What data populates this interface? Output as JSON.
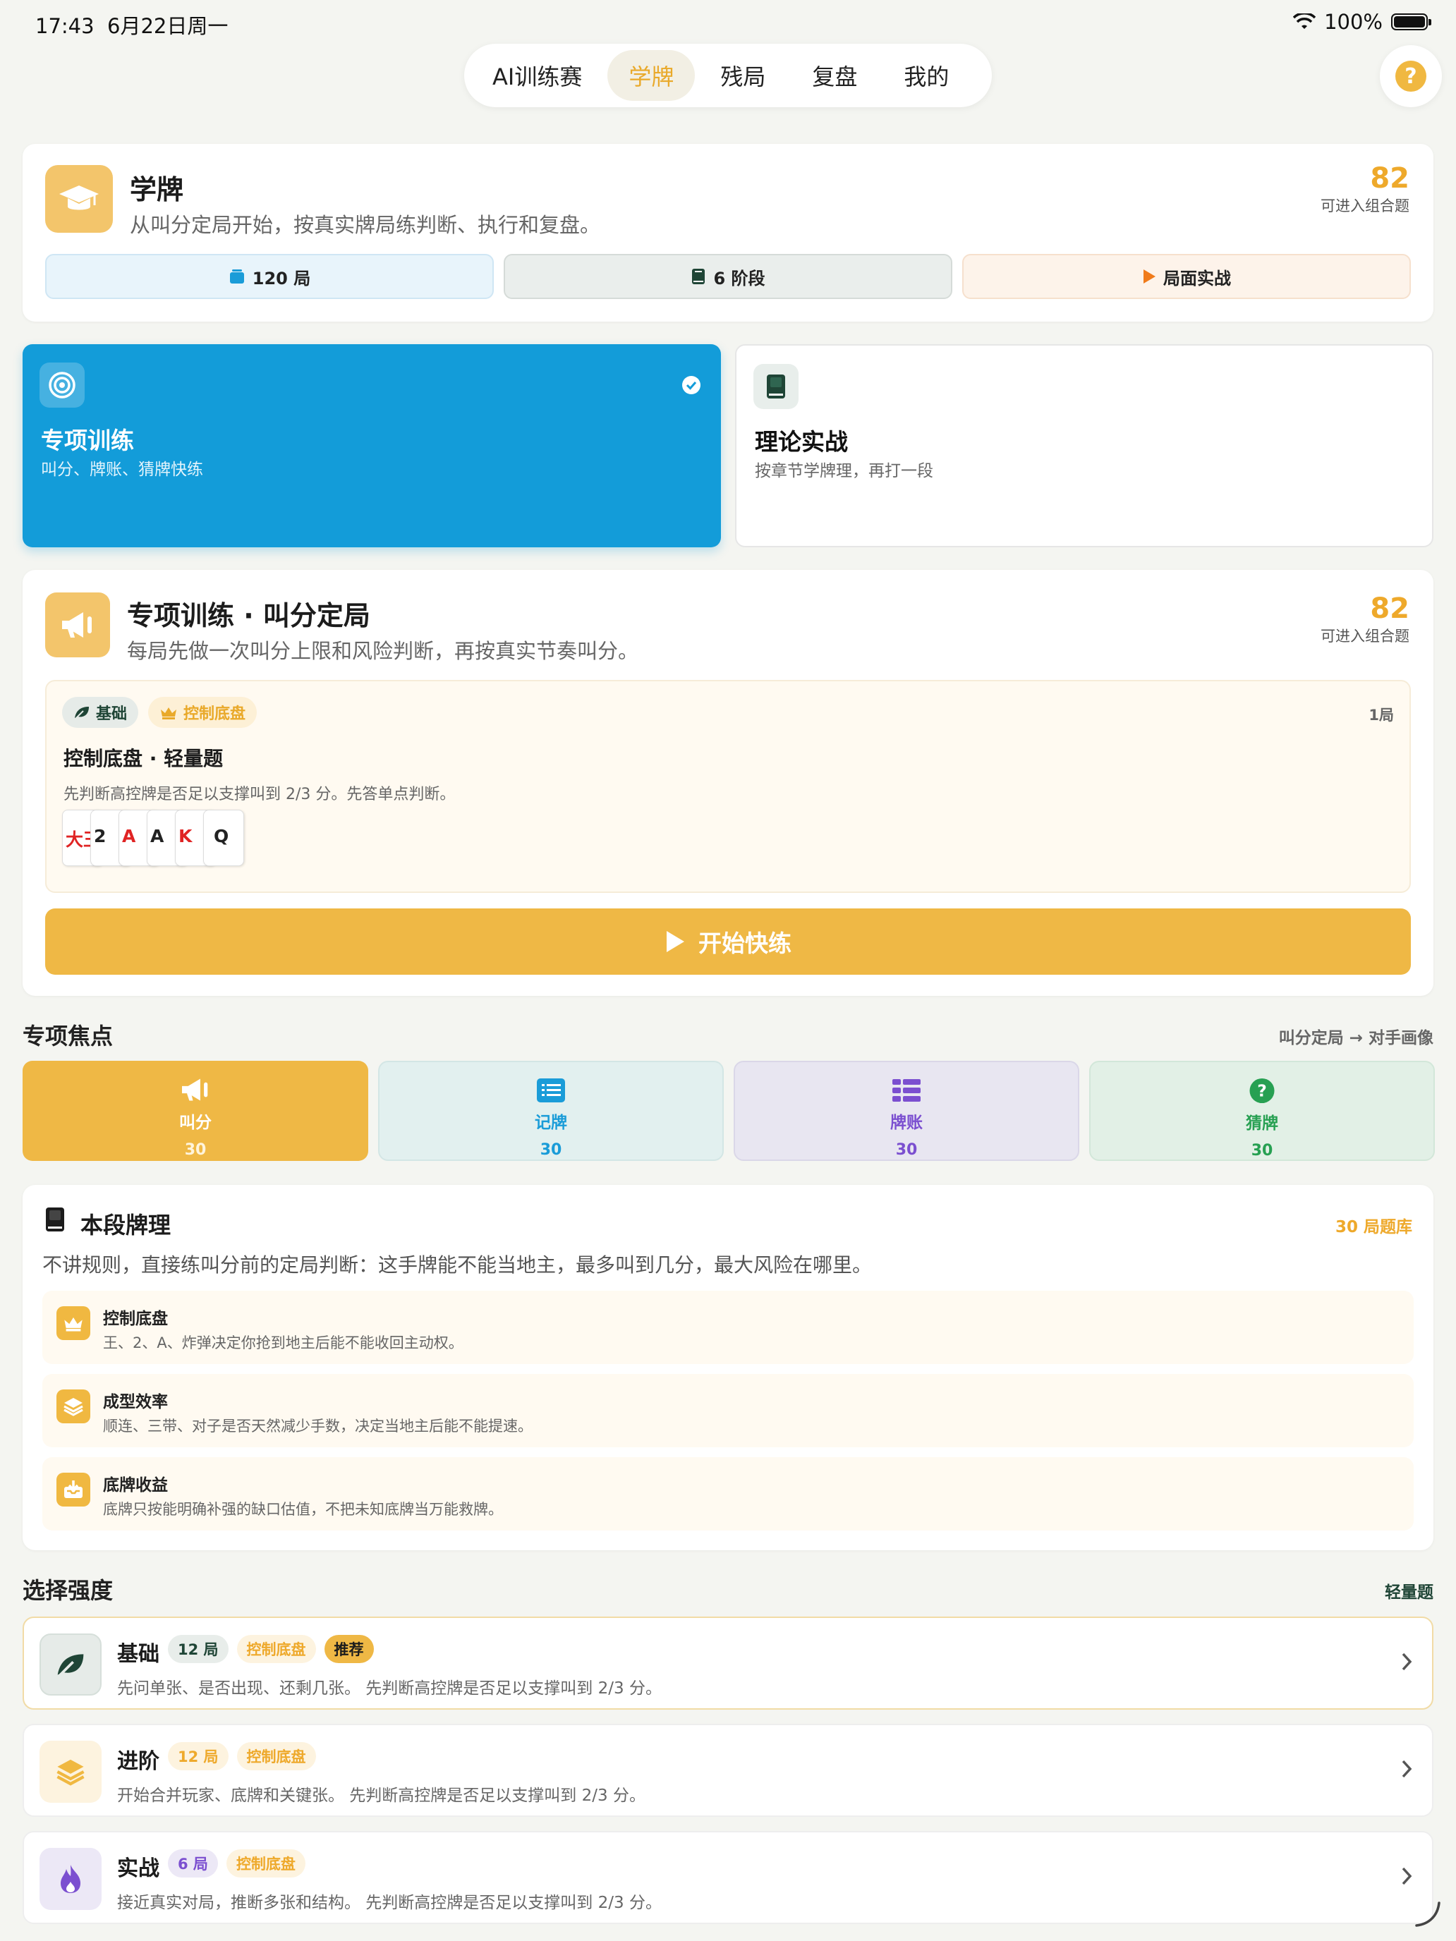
{
  "status": {
    "time": "17:43",
    "date": "6月22日周一",
    "battery": "100%"
  },
  "nav": {
    "tabs": [
      "AI训练赛",
      "学牌",
      "残局",
      "复盘",
      "我的"
    ],
    "active": 1,
    "help": "?"
  },
  "header": {
    "title": "学牌",
    "subtitle": "从叫分定局开始，按真实牌局练判断、执行和复盘。",
    "score": "82",
    "score_label": "可进入组合题",
    "pills": [
      {
        "label": "120 局",
        "icon": "deck-icon"
      },
      {
        "label": "6 阶段",
        "icon": "book-icon"
      },
      {
        "label": "局面实战",
        "icon": "play-icon"
      }
    ]
  },
  "modes": [
    {
      "title": "专项训练",
      "subtitle": "叫分、牌账、猜牌快练",
      "selected": true
    },
    {
      "title": "理论实战",
      "subtitle": "按章节学牌理，再打一段",
      "selected": false
    }
  ],
  "training": {
    "title": "专项训练 · 叫分定局",
    "subtitle": "每局先做一次叫分上限和风险判断，再按真实节奏叫分。",
    "score": "82",
    "score_label": "可进入组合题",
    "question": {
      "tag_level": "基础",
      "tag_topic": "控制底盘",
      "count": "1局",
      "title": "控制底盘 · 轻量题",
      "desc": "先判断高控牌是否足以支撑叫到 2/3 分。先答单点判断。",
      "cards": [
        {
          "label": "大王",
          "color": "#e02424"
        },
        {
          "label": "2",
          "color": "#222222"
        },
        {
          "label": "A",
          "color": "#e02424"
        },
        {
          "label": "A",
          "color": "#222222"
        },
        {
          "label": "K",
          "color": "#e02424"
        },
        {
          "label": "Q",
          "color": "#222222"
        }
      ]
    },
    "start_label": "开始快练"
  },
  "focus": {
    "title": "专项焦点",
    "path": "叫分定局 → 对手画像",
    "items": [
      {
        "label": "叫分",
        "count": "30",
        "bg": "#efb845",
        "fg": "#ffffff",
        "active": true
      },
      {
        "label": "记牌",
        "count": "30",
        "bg": "#e2f0ef",
        "fg": "#1a9cd8",
        "active": false
      },
      {
        "label": "牌账",
        "count": "30",
        "bg": "#e8e6f1",
        "fg": "#7b4fd0",
        "active": false
      },
      {
        "label": "猜牌",
        "count": "30",
        "bg": "#e2f0e6",
        "fg": "#27a052",
        "active": false
      }
    ]
  },
  "theory": {
    "title": "本段牌理",
    "bank": "30 局题库",
    "intro": "不讲规则，直接练叫分前的定局判断：这手牌能不能当地主，最多叫到几分，最大风险在哪里。",
    "items": [
      {
        "title": "控制底盘",
        "desc": "王、2、A、炸弹决定你抢到地主后能不能收回主动权。",
        "icon": "crown-icon"
      },
      {
        "title": "成型效率",
        "desc": "顺连、三带、对子是否天然减少手数，决定当地主后能不能提速。",
        "icon": "layers-icon"
      },
      {
        "title": "底牌收益",
        "desc": "底牌只按能明确补强的缺口估值，不把未知底牌当万能救牌。",
        "icon": "inbox-icon"
      }
    ]
  },
  "intensity": {
    "title": "选择强度",
    "current": "轻量题",
    "levels": [
      {
        "title": "基础",
        "count": "12 局",
        "topic": "控制底盘",
        "badge": "推荐",
        "desc": "先问单张、是否出现、还剩几张。 先判断高控牌是否足以支撑叫到 2/3 分。"
      },
      {
        "title": "进阶",
        "count": "12 局",
        "topic": "控制底盘",
        "badge": "",
        "desc": "开始合并玩家、底牌和关键张。 先判断高控牌是否足以支撑叫到 2/3 分。"
      },
      {
        "title": "实战",
        "count": "6 局",
        "topic": "控制底盘",
        "badge": "",
        "desc": "接近真实对局，推断多张和结构。 先判断高控牌是否足以支撑叫到 2/3 分。"
      }
    ]
  },
  "colors": {
    "accent": "#efb845",
    "blue": "#139cd9",
    "orange_text": "#eea92b"
  }
}
